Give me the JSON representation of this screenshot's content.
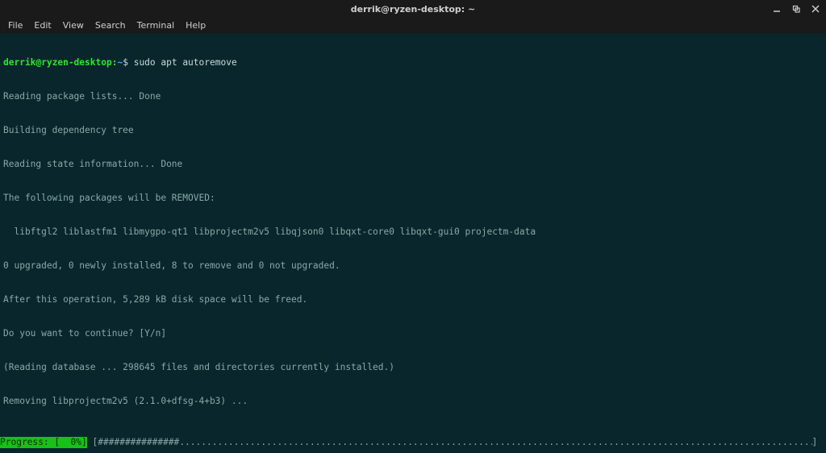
{
  "window": {
    "title": "derrik@ryzen-desktop: ~"
  },
  "menubar": {
    "items": [
      {
        "label": "File"
      },
      {
        "label": "Edit"
      },
      {
        "label": "View"
      },
      {
        "label": "Search"
      },
      {
        "label": "Terminal"
      },
      {
        "label": "Help"
      }
    ]
  },
  "prompt": {
    "user_host": "derrik@ryzen-desktop",
    "colon": ":",
    "path": "~",
    "symbol": "$ ",
    "command": "sudo apt autoremove"
  },
  "output": {
    "l1": "Reading package lists... Done",
    "l2": "Building dependency tree",
    "l3": "Reading state information... Done",
    "l4": "The following packages will be REMOVED:",
    "l5": "  libftgl2 liblastfm1 libmygpo-qt1 libprojectm2v5 libqjson0 libqxt-core0 libqxt-gui0 projectm-data",
    "l6": "0 upgraded, 0 newly installed, 8 to remove and 0 not upgraded.",
    "l7": "After this operation, 5,289 kB disk space will be freed.",
    "l8": "Do you want to continue? [Y/n]",
    "l9": "(Reading database ... 298645 files and directories currently installed.)",
    "l10": "Removing libprojectm2v5 (2.1.0+dfsg-4+b3) ..."
  },
  "progress": {
    "label": "Progress: [  0%]",
    "open": " [",
    "fill": "###############",
    "dots": ".........................................................................................................................................................",
    "close": "] "
  }
}
